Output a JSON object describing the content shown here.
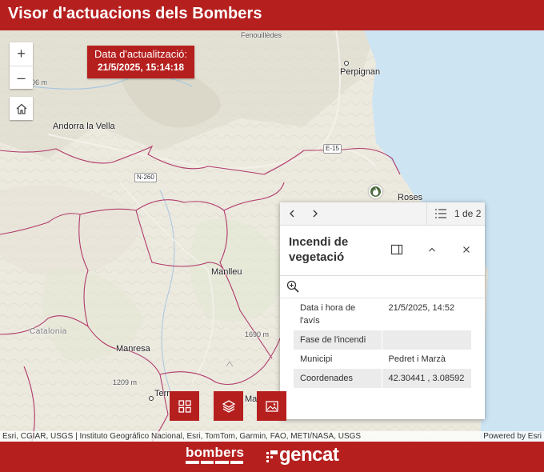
{
  "header": {
    "title": "Visor d'actuacions dels Bombers"
  },
  "map": {
    "update_label": "Data d'actualització:",
    "update_value": "21/5/2025, 15:14:18",
    "places": {
      "perpignan": "Perpignan",
      "andorra": "Andorra la Vella",
      "roses": "Roses",
      "manlleu": "Manlleu",
      "manresa": "Manresa",
      "catalonia": "Catalonia",
      "fenouilledes": "Fenouillèdes",
      "terr": "Terr",
      "ma": "Ma",
      "elev1": "06 m",
      "elev2": "1690 m",
      "elev3": "1209 m"
    },
    "roads": {
      "n260": "N-260",
      "e15": "E-15"
    },
    "attribution_left": "Esri, CGIAR, USGS | Instituto Geográfico Nacional, Esri, TomTom, Garmin, FAO, METI/NASA, USGS",
    "attribution_right": "Powered by Esri"
  },
  "controls": {
    "zoom_in": "+",
    "zoom_out": "–"
  },
  "popup": {
    "counter": "1 de 2",
    "title": "Incendi de vegetació",
    "fields": [
      {
        "key": "Data i hora de l'avís",
        "value": "21/5/2025, 14:52"
      },
      {
        "key": "Fase de l'incendi",
        "value": ""
      },
      {
        "key": "Municipi",
        "value": "Pedret i Marzà"
      },
      {
        "key": "Coordenades",
        "value": "42.30441 , 3.08592"
      }
    ]
  },
  "footer": {
    "logo_bombers": "bombers",
    "logo_gencat": "gencat"
  },
  "colors": {
    "brand_red": "#b5201f",
    "sea": "#cde4f3",
    "border": "#b03a6a"
  },
  "icons": [
    "plus-icon",
    "minus-icon",
    "home-icon",
    "fire-icon",
    "chevron-left-icon",
    "chevron-right-icon",
    "list-icon",
    "dock-icon",
    "collapse-icon",
    "close-icon",
    "zoom-to-icon",
    "grid-icon",
    "layers-icon",
    "image-icon"
  ]
}
